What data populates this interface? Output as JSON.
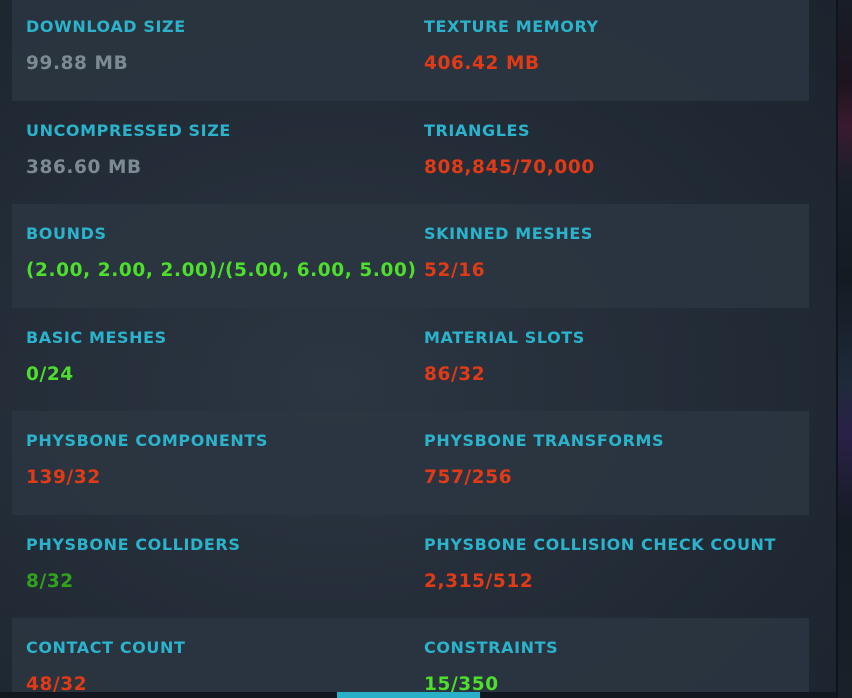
{
  "stats": [
    [
      {
        "label": "DOWNLOAD SIZE",
        "value": "99.88 MB",
        "status": "neutral"
      },
      {
        "label": "TEXTURE MEMORY",
        "value": "406.42 MB",
        "status": "bad"
      }
    ],
    [
      {
        "label": "UNCOMPRESSED SIZE",
        "value": "386.60 MB",
        "status": "neutral"
      },
      {
        "label": "TRIANGLES",
        "value": "808,845/70,000",
        "status": "bad"
      }
    ],
    [
      {
        "label": "BOUNDS",
        "value": "(2.00, 2.00, 2.00)/(5.00, 6.00, 5.00)",
        "status": "good"
      },
      {
        "label": "SKINNED MESHES",
        "value": "52/16",
        "status": "bad"
      }
    ],
    [
      {
        "label": "BASIC MESHES",
        "value": "0/24",
        "status": "good"
      },
      {
        "label": "MATERIAL SLOTS",
        "value": "86/32",
        "status": "bad"
      }
    ],
    [
      {
        "label": "PHYSBONE COMPONENTS",
        "value": "139/32",
        "status": "bad"
      },
      {
        "label": "PHYSBONE TRANSFORMS",
        "value": "757/256",
        "status": "bad"
      }
    ],
    [
      {
        "label": "PHYSBONE COLLIDERS",
        "value": "8/32",
        "status": "ok"
      },
      {
        "label": "PHYSBONE COLLISION CHECK COUNT",
        "value": "2,315/512",
        "status": "bad"
      }
    ],
    [
      {
        "label": "CONTACT COUNT",
        "value": "48/32",
        "status": "bad"
      },
      {
        "label": "CONSTRAINTS",
        "value": "15/350",
        "status": "good"
      }
    ]
  ],
  "colors": {
    "label": "#2bb3cc",
    "neutral": "#7d8a94",
    "bad": "#e03a16",
    "good": "#4ede2c",
    "ok": "#30a21c",
    "scroll_thumb": "#29b0c8"
  }
}
